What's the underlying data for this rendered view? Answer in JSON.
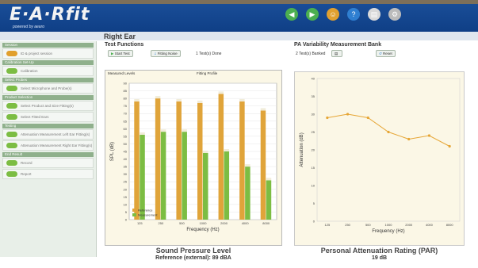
{
  "app": {
    "logo": "E·A·Rfit",
    "tagline": "powered by aearo"
  },
  "header": {
    "icons": [
      {
        "name": "back-icon",
        "color": "#4caf50",
        "glyph": "◀"
      },
      {
        "name": "forward-icon",
        "color": "#4caf50",
        "glyph": "▶"
      },
      {
        "name": "users-icon",
        "color": "#e0a030",
        "glyph": "☺"
      },
      {
        "name": "help-icon",
        "color": "#2f7fd1",
        "glyph": "?"
      },
      {
        "name": "print-icon",
        "color": "#d9d9d9",
        "glyph": "▤"
      },
      {
        "name": "settings-icon",
        "color": "#bbbbbb",
        "glyph": "⚙"
      }
    ]
  },
  "page_title": "Right Ear",
  "test_functions": {
    "label": "Test Functions",
    "start_label": "Start Test",
    "fitting_label": "Fitting Noise",
    "status": "1 Test(s) Done"
  },
  "pa_variability": {
    "label": "PA Variability Measurement Bank",
    "status": "2 Test(s) Banked",
    "reset_label": "Reset"
  },
  "left_chart": {
    "header_left": "Measured Levels",
    "header_right": "Fitting Profile",
    "footer_title": "Sound Pressure Level",
    "footer_sub": "Reference (external): 89 dBA"
  },
  "right_chart": {
    "footer_title": "Personal Attenuation Rating (PAR)",
    "footer_sub": "19 dB"
  },
  "chart_data": [
    {
      "type": "bar",
      "xlabel": "Frequency (Hz)",
      "ylabel": "SPL (dB)",
      "categories": [
        "125",
        "250",
        "500",
        "1000",
        "2000",
        "4000",
        "8000"
      ],
      "ylim": [
        0,
        90
      ],
      "yticks": [
        0,
        5,
        10,
        15,
        20,
        25,
        30,
        35,
        40,
        45,
        50,
        55,
        60,
        65,
        70,
        75,
        80,
        85,
        90
      ],
      "series": [
        {
          "name": "Reference",
          "color": "#e0a43a",
          "values": [
            78,
            80,
            78,
            77,
            83,
            78,
            72
          ]
        },
        {
          "name": "Measurement",
          "color": "#7cbd43",
          "values": [
            56,
            58,
            58,
            44,
            45,
            35,
            26
          ]
        }
      ],
      "legend": "bottom-left",
      "grid": true
    },
    {
      "type": "line",
      "xlabel": "Frequency (Hz)",
      "ylabel": "Attenuation (dB)",
      "categories": [
        "125",
        "250",
        "500",
        "1000",
        "2000",
        "4000",
        "8000"
      ],
      "ylim": [
        0,
        40
      ],
      "yticks": [
        0,
        5,
        10,
        15,
        20,
        25,
        30,
        35,
        40
      ],
      "series": [
        {
          "color": "#e6a636",
          "values": [
            29,
            30,
            29,
            25,
            23,
            24,
            21
          ]
        }
      ],
      "grid": true
    }
  ],
  "sidebar": {
    "sections": [
      {
        "title": "Session",
        "items": [
          {
            "label": "ID & project session",
            "dot": "orange"
          }
        ]
      },
      {
        "title": "Calibration Set-Up",
        "items": [
          {
            "label": "Calibration",
            "dot": "green"
          }
        ]
      },
      {
        "title": "Select Probes",
        "items": [
          {
            "label": "Select Microphone and Probe(s)",
            "dot": "green"
          }
        ]
      },
      {
        "title": "Product Selection",
        "items": [
          {
            "label": "Select Product and Size Fitting(s)",
            "dot": "green"
          },
          {
            "label": "Select Fitted Ears",
            "dot": "green"
          }
        ]
      },
      {
        "title": "Testing",
        "items": [
          {
            "label": "Attenuation Measurement Left Ear Fitting(s)",
            "dot": "green"
          },
          {
            "label": "Attenuation Measurement Right Ear Fitting(s)",
            "dot": "green"
          }
        ]
      },
      {
        "title": "End Result",
        "items": [
          {
            "label": "Record",
            "dot": "green"
          },
          {
            "label": "Report",
            "dot": "green"
          }
        ]
      }
    ]
  }
}
